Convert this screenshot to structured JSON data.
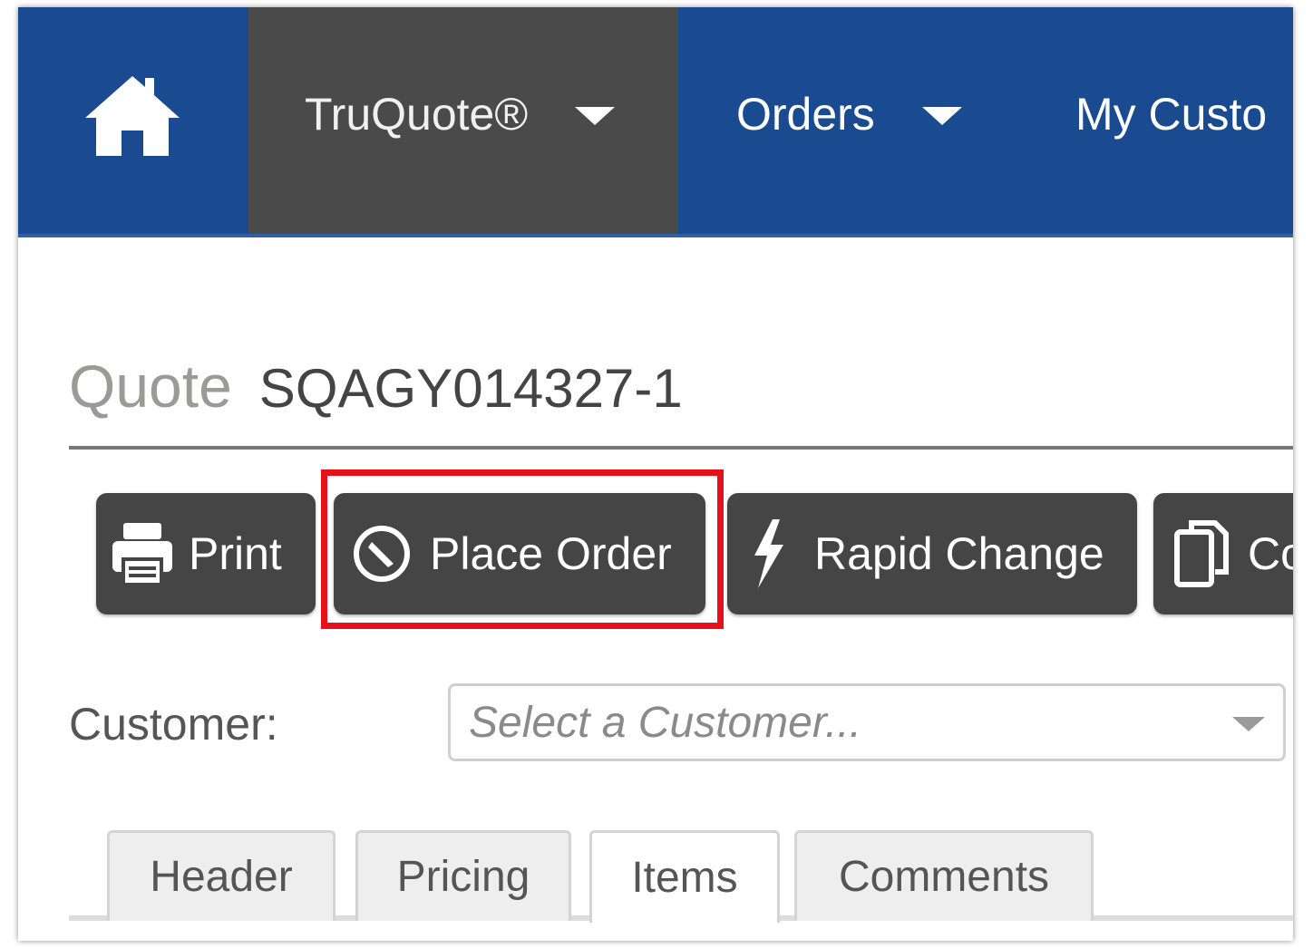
{
  "nav": {
    "home_icon": "home-icon",
    "items": [
      {
        "label": "TruQuote®",
        "active": true
      },
      {
        "label": "Orders",
        "active": false
      },
      {
        "label": "My Custo",
        "active": false
      }
    ]
  },
  "quote": {
    "prefix": "Quote",
    "number": "SQAGY014327-1"
  },
  "toolbar": {
    "print_label": "Print",
    "place_order_label": "Place Order",
    "rapid_change_label": "Rapid Change",
    "copy_label": "Co",
    "icons": {
      "print": "printer-icon",
      "place_order": "compass-icon",
      "rapid_change": "lightning-icon",
      "copy": "copy-icon"
    }
  },
  "customer": {
    "label": "Customer:",
    "placeholder": "Select a Customer..."
  },
  "tabs": [
    {
      "label": "Header",
      "active": false
    },
    {
      "label": "Pricing",
      "active": false
    },
    {
      "label": "Items",
      "active": true
    },
    {
      "label": "Comments",
      "active": false
    }
  ],
  "colors": {
    "nav_bg": "#1a4b91",
    "nav_active_bg": "#4a4a4a",
    "button_bg": "#454545",
    "highlight": "#e8101a"
  }
}
